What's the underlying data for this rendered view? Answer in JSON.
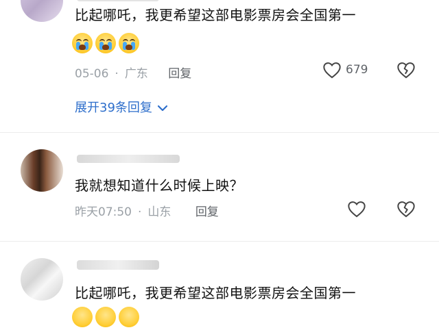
{
  "comments": [
    {
      "text": "比起哪吒，我更希望这部电影票房会全国第一",
      "date": "05-06",
      "location": "广东",
      "reply_label": "回复",
      "likes": "679",
      "emoji_count": 3
    },
    {
      "username": "",
      "text": "我就想知道什么时候上映？",
      "date": "昨天07:50",
      "location": "山东",
      "reply_label": "回复"
    },
    {
      "username": "",
      "text": "比起哪吒，我更希望这部电影票房会全国第一"
    }
  ],
  "expand_replies": "展开39条回复",
  "separator": "·",
  "icons": {
    "like": "heart-outline-icon",
    "dislike": "broken-heart-icon",
    "expand": "chevron-down-icon"
  },
  "colors": {
    "link": "#2d6ecb",
    "meta": "#9aa0a6",
    "divider": "#ececec"
  }
}
